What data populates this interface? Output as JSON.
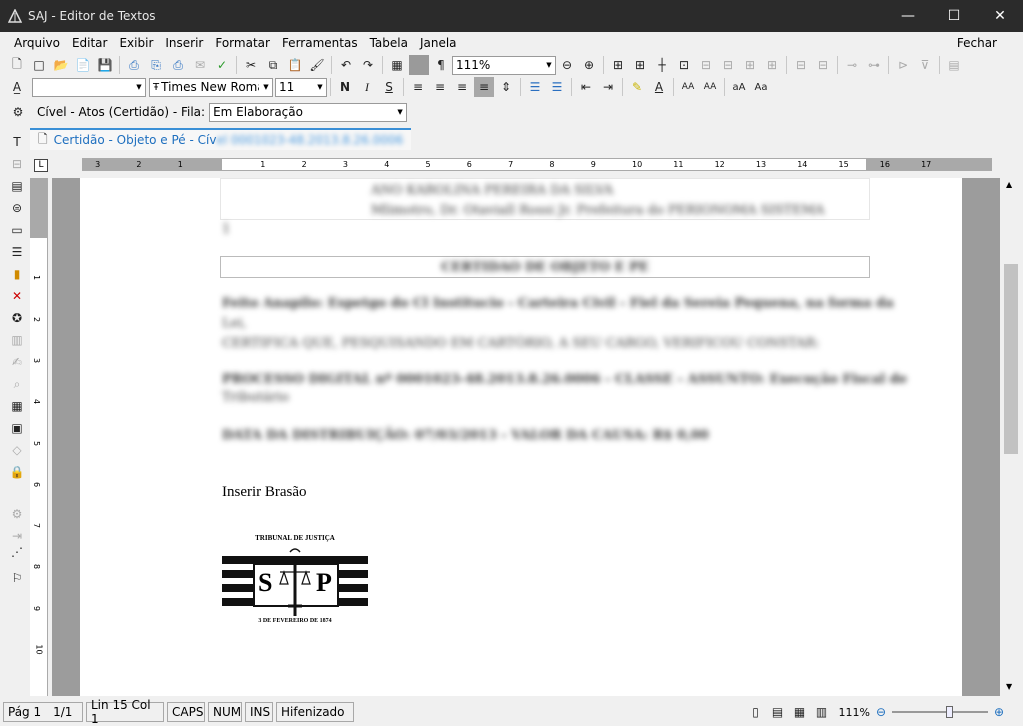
{
  "window": {
    "title": "SAJ - Editor de Textos",
    "minimize": "—",
    "maximize": "☐",
    "close": "✕"
  },
  "menu": [
    "Arquivo",
    "Editar",
    "Exibir",
    "Inserir",
    "Formatar",
    "Ferramentas",
    "Tabela",
    "Janela"
  ],
  "menu_right": "Fechar",
  "toolbar": {
    "zoom": "111%",
    "font": "Times New Roman",
    "size": "11"
  },
  "fila_bar": {
    "label": "Cível - Atos (Certidão) - Fila:",
    "value": "Em Elaboração"
  },
  "doc_tab": {
    "label": "Certidão - Objeto e Pé - Cív",
    "hidden_tail": "el 0001023-48.2013.8.26.0006"
  },
  "ruler": {
    "left_numbers": [
      "3",
      "2",
      "1"
    ],
    "numbers": [
      "1",
      "2",
      "3",
      "4",
      "5",
      "6",
      "7",
      "8",
      "9",
      "10",
      "11",
      "12",
      "13",
      "14",
      "15",
      "16",
      "17"
    ]
  },
  "vruler": {
    "numbers": [
      "1",
      "2",
      "3",
      "4",
      "5",
      "6",
      "7",
      "8",
      "9",
      "10"
    ]
  },
  "document": {
    "top_box_line1": "ANO KAROLINA PEREIRA DA SILVA",
    "top_box_line2": "Mlimotro, Dr. Otaviall Rossi Jr. Prefeitura do PERIONOMA SISTEMA",
    "mark_1": "1",
    "heading": "CERTIDAO DE OBJETO E PE",
    "p1_line1": "Feito Anapilo: Espetgo do Cl Institucio - Carteira Civil - Fiel da Sereia Pequena, na forma da",
    "p1_line2": "Lei,",
    "p1_line3": "CERTIFICA QUE, PESQUISANDO EM CARTÓRIO, A SEU CARGO, VERIFICOU CONSTAR:",
    "p2_line1": "PROCESSO DIGITAL nº 0001023-48.2013.8.26.0006 - CLASSE - ASSUNTO: Execução Fiscal de",
    "p2_line2": "Tributário",
    "p3": "DATA DA DISTRIBUIÇÃO: 07/03/2013 - VALOR DA CAUSA: R$ 0,00",
    "inserir_brasao": "Inserir Brasão",
    "brasao": {
      "top": "TRIBUNAL DE JUSTIÇA",
      "left": "S",
      "right": "P",
      "bottom": "3 DE FEVEREIRO DE 1874"
    }
  },
  "status": {
    "page": "Pág 1",
    "pages": "1/1",
    "position": "Lin 15  Col 1",
    "caps": "CAPS",
    "num": "NUM",
    "ins": "INS",
    "hifen": "Hifenizado",
    "zoom": "111%"
  }
}
